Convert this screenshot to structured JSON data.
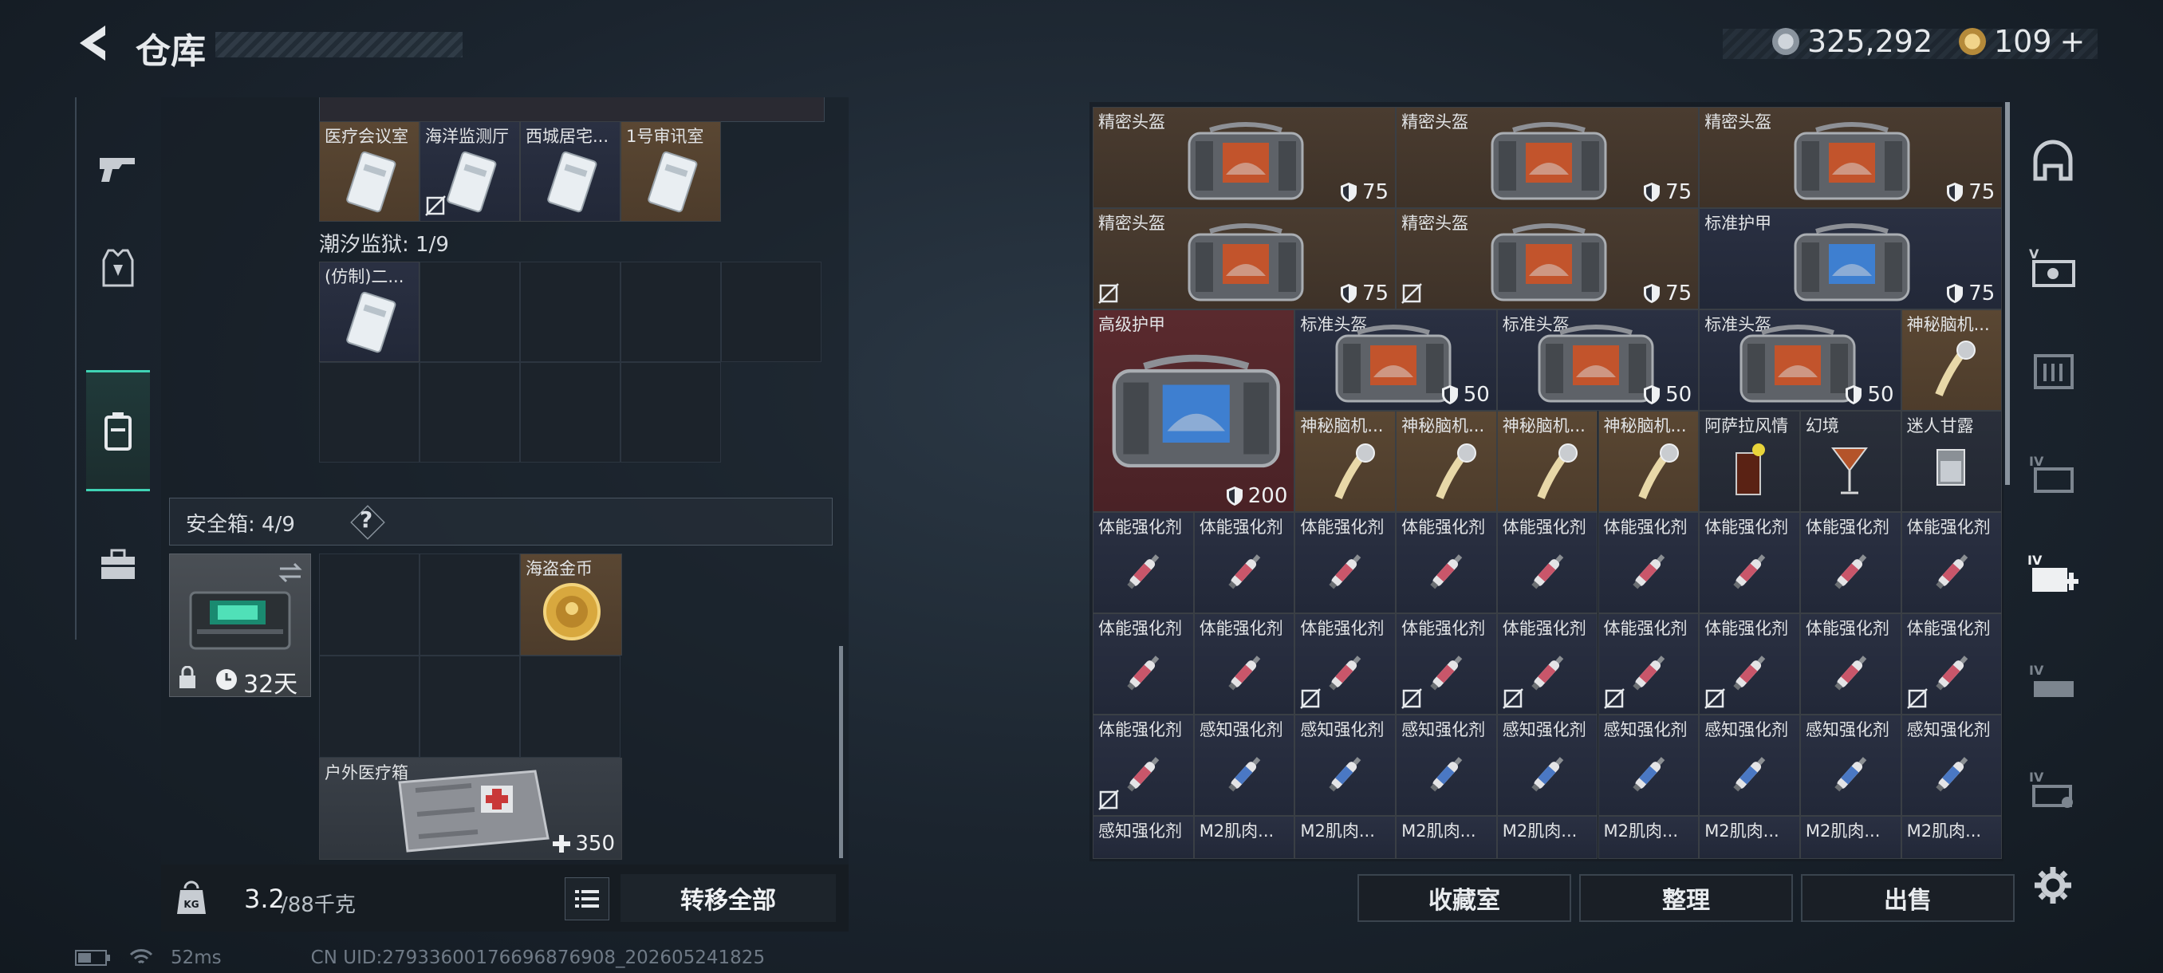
{
  "header": {
    "title": "仓库",
    "currency_silver": "325,292",
    "currency_gold": "109",
    "gold_plus": "+"
  },
  "left": {
    "top_items": [
      {
        "label": "医疗会议室",
        "nosell": false
      },
      {
        "label": "海洋监测厅",
        "nosell": true
      },
      {
        "label": "西城居宅...",
        "nosell": false
      },
      {
        "label": "1号审讯室",
        "nosell": false
      }
    ],
    "prison_label": "潮汐监狱: 1/9",
    "prison_item": "(仿制)二...",
    "safe_label": "安全箱: 4/9",
    "safe_help": "?",
    "safe_days": "32天",
    "coin_label": "海盗金币",
    "medkit_label": "户外医疗箱",
    "medkit_value": "350",
    "weight_value": "3.2",
    "weight_cap": "/88千克",
    "transfer_all": "转移全部"
  },
  "right": {
    "row1": [
      {
        "label": "精密头盔",
        "value": "75"
      },
      {
        "label": "精密头盔",
        "value": "75"
      },
      {
        "label": "精密头盔",
        "value": "75"
      }
    ],
    "row2": [
      {
        "label": "精密头盔",
        "value": "75",
        "nosell": true
      },
      {
        "label": "精密头盔",
        "value": "75",
        "nosell": true
      },
      {
        "label": "标准护甲",
        "value": "75",
        "nosell": false
      }
    ],
    "armor_big": {
      "label": "高级护甲",
      "value": "200"
    },
    "row3": [
      {
        "label": "标准头盔",
        "value": "50"
      },
      {
        "label": "标准头盔",
        "value": "50"
      },
      {
        "label": "标准头盔",
        "value": "50"
      }
    ],
    "brain1": "神秘脑机...",
    "row4": [
      {
        "label": "神秘脑机..."
      },
      {
        "label": "神秘脑机..."
      },
      {
        "label": "神秘脑机..."
      },
      {
        "label": "神秘脑机..."
      },
      {
        "label": "阿萨拉风情"
      },
      {
        "label": "幻境"
      },
      {
        "label": "迷人甘露"
      }
    ],
    "row5": [
      "体能强化剂",
      "体能强化剂",
      "体能强化剂",
      "体能强化剂",
      "体能强化剂",
      "体能强化剂",
      "体能强化剂",
      "体能强化剂",
      "体能强化剂"
    ],
    "row6": [
      "体能强化剂",
      "体能强化剂",
      "体能强化剂",
      "体能强化剂",
      "体能强化剂",
      "体能强化剂",
      "体能强化剂",
      "体能强化剂",
      "体能强化剂"
    ],
    "row6_nosell": [
      false,
      false,
      true,
      true,
      true,
      true,
      true,
      false,
      true
    ],
    "row7": [
      "体能强化剂",
      "感知强化剂",
      "感知强化剂",
      "感知强化剂",
      "感知强化剂",
      "感知强化剂",
      "感知强化剂",
      "感知强化剂",
      "感知强化剂"
    ],
    "row8": [
      "感知强化剂",
      "M2肌肉...",
      "M2肌肉...",
      "M2肌肉...",
      "M2肌肉...",
      "M2肌肉...",
      "M2肌肉...",
      "M2肌肉...",
      "M2肌肉..."
    ],
    "btn_collection": "收藏室",
    "btn_sort": "整理",
    "btn_sell": "出售"
  },
  "status": {
    "ping": "52ms",
    "uid": "CN UID:27933600176696876908_202605241825"
  },
  "colors": {
    "accent": "#3fd3b4",
    "brown": "#4a3c30",
    "red": "#5a2a2e",
    "stim_red": "#c9566a",
    "stim_blue": "#4a78c4"
  }
}
